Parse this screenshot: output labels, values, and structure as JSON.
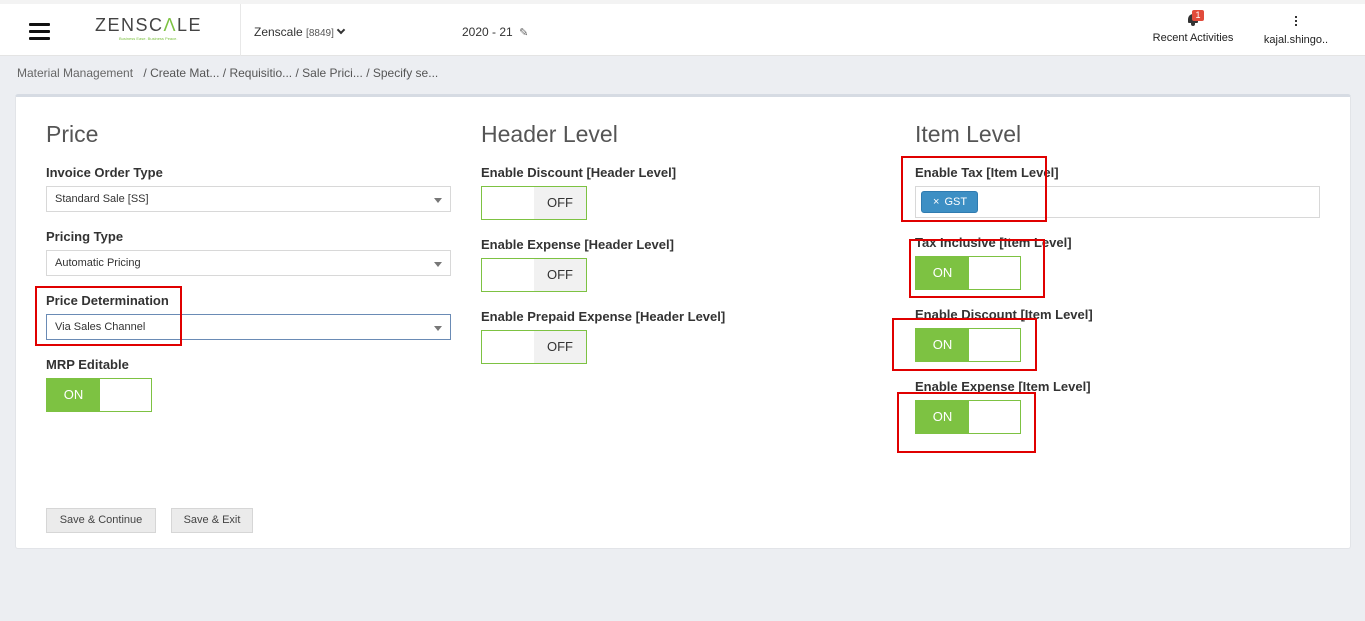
{
  "header": {
    "logo": {
      "word_main": "ZENSC",
      "word_accent": "Λ",
      "word_end": "LE",
      "tagline": "Business Ease. Business Peace."
    },
    "company": {
      "name": "Zenscale",
      "code": "[8849]"
    },
    "fiscal_year": "2020 - 21",
    "recent_activities": {
      "label": "Recent Activities",
      "badge": "1"
    },
    "user": {
      "label": "kajal.shingo.."
    }
  },
  "breadcrumb": {
    "root": "Material Management",
    "items": [
      "/ Create Mat...",
      "/ Requisitio...",
      "/ Sale Prici...",
      "/ Specify se..."
    ]
  },
  "price": {
    "title": "Price",
    "invoice_order_type": {
      "label": "Invoice Order Type",
      "value": "Standard Sale [SS]"
    },
    "pricing_type": {
      "label": "Pricing Type",
      "value": "Automatic Pricing"
    },
    "price_determination": {
      "label": "Price Determination",
      "value": "Via Sales Channel"
    },
    "mrp_editable": {
      "label": "MRP Editable",
      "state": "ON"
    }
  },
  "header_level": {
    "title": "Header Level",
    "enable_discount": {
      "label": "Enable Discount [Header Level]",
      "state": "OFF"
    },
    "enable_expense": {
      "label": "Enable Expense [Header Level]",
      "state": "OFF"
    },
    "enable_prepaid_expense": {
      "label": "Enable Prepaid Expense [Header Level]",
      "state": "OFF"
    }
  },
  "item_level": {
    "title": "Item Level",
    "enable_tax": {
      "label": "Enable Tax [Item Level]",
      "tag_remove": "×",
      "tags": [
        "GST"
      ]
    },
    "tax_inclusive": {
      "label": "Tax Inclusive [Item Level]",
      "state": "ON"
    },
    "enable_discount": {
      "label": "Enable Discount [Item Level]",
      "state": "ON"
    },
    "enable_expense": {
      "label": "Enable Expense [Item Level]",
      "state": "ON"
    }
  },
  "actions": {
    "save_continue": "Save & Continue",
    "save_exit": "Save & Exit"
  },
  "colors": {
    "toggle_on": "#7dc242",
    "tag": "#3d8fc4",
    "highlight": "#e00000",
    "badge": "#e14b3b"
  }
}
